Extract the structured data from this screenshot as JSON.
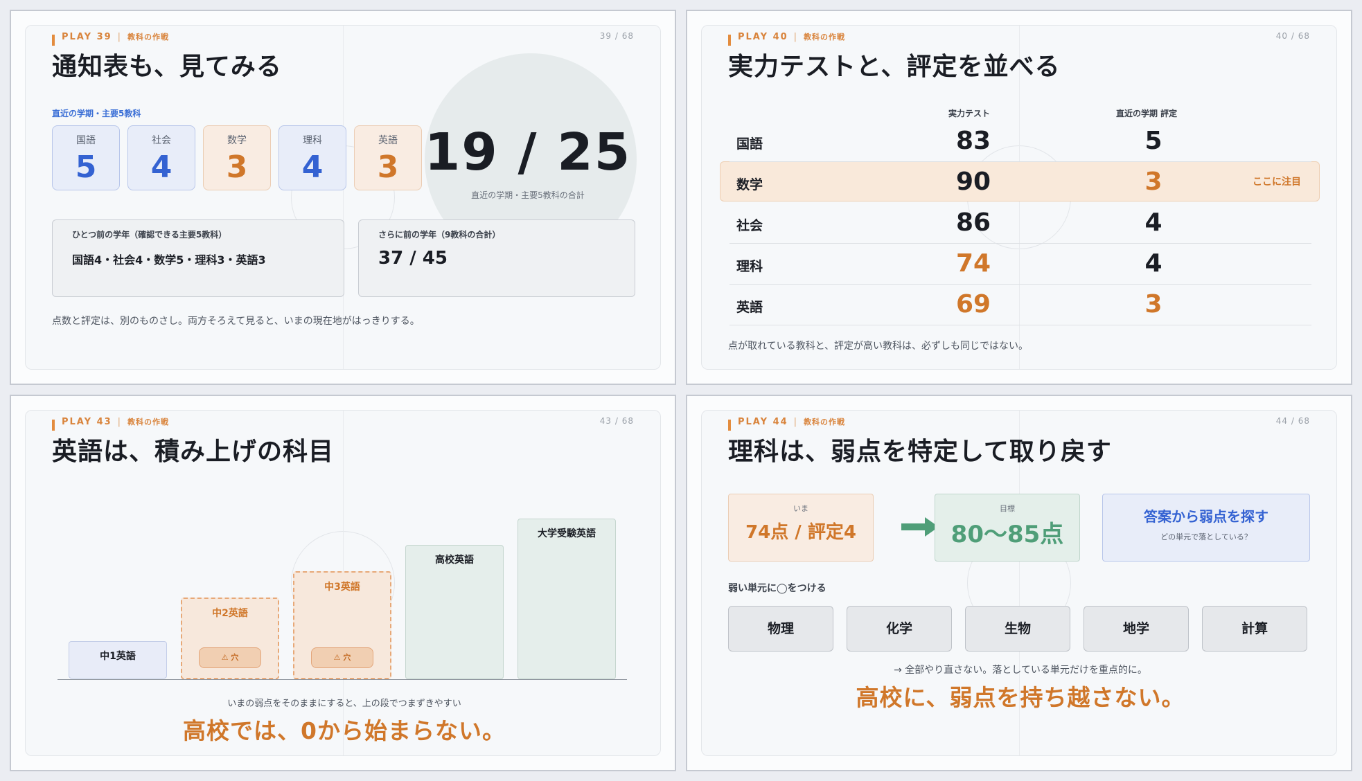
{
  "slide1": {
    "play": "PLAY 39",
    "category": "教科の作戦",
    "page": "39 / 68",
    "title": "通知表も、見てみる",
    "section_label": "直近の学期・主要5教科",
    "subjects": [
      {
        "name": "国語",
        "grade": "5",
        "color": "blue"
      },
      {
        "name": "社会",
        "grade": "4",
        "color": "blue"
      },
      {
        "name": "数学",
        "grade": "3",
        "color": "orange"
      },
      {
        "name": "理科",
        "grade": "4",
        "color": "blue"
      },
      {
        "name": "英語",
        "grade": "3",
        "color": "orange"
      }
    ],
    "total": "19 / 25",
    "total_caption": "直近の学期・主要5教科の合計",
    "prev_year": {
      "heading": "ひとつ前の学年（確認できる主要5教科）",
      "body": "国語4・社会4・数学5・理科3・英語3"
    },
    "prev_prev_year": {
      "heading": "さらに前の学年（9教科の合計）",
      "body": "37 / 45"
    },
    "footer": "点数と評定は、別のものさし。両方そろえて見ると、いまの現在地がはっきりする。"
  },
  "slide2": {
    "play": "PLAY 40",
    "category": "教科の作戦",
    "page": "40 / 68",
    "title": "実力テストと、評定を並べる",
    "col_test": "実力テスト",
    "col_rating": "直近の学期 評定",
    "rows": [
      {
        "subject": "国語",
        "score": "83",
        "rating": "5",
        "score_color": "#1a1d24",
        "rating_color": "#1a1d24"
      },
      {
        "subject": "数学",
        "score": "90",
        "rating": "3",
        "score_color": "#1a1d24",
        "rating_color": "#d0772a"
      },
      {
        "subject": "社会",
        "score": "86",
        "rating": "4",
        "score_color": "#1a1d24",
        "rating_color": "#1a1d24"
      },
      {
        "subject": "理科",
        "score": "74",
        "rating": "4",
        "score_color": "#d0772a",
        "rating_color": "#1a1d24"
      },
      {
        "subject": "英語",
        "score": "69",
        "rating": "3",
        "score_color": "#d0772a",
        "rating_color": "#d0772a"
      }
    ],
    "note": "ここに注目",
    "footer": "点が取れている教科と、評定が高い教科は、必ずしも同じではない。"
  },
  "slide3": {
    "play": "PLAY 43",
    "category": "教科の作戦",
    "page": "43 / 68",
    "title": "英語は、積み上げの科目",
    "steps": [
      {
        "label": "中1英語"
      },
      {
        "label": "中2英語",
        "badge": "⚠ 穴"
      },
      {
        "label": "中3英語",
        "badge": "⚠ 穴"
      },
      {
        "label": "高校英語"
      },
      {
        "label": "大学受験英語"
      }
    ],
    "caption": "いまの弱点をそのままにすると、上の段でつまずきやすい",
    "message": "高校では、0から始まらない。"
  },
  "slide4": {
    "play": "PLAY 44",
    "category": "教科の作戦",
    "page": "44 / 68",
    "title": "理科は、弱点を特定して取り戻す",
    "now": {
      "key": "いま",
      "value": "74点 / 評定4"
    },
    "goal": {
      "key": "目標",
      "value": "80〜85点"
    },
    "action": {
      "title": "答案から弱点を探す",
      "sub": "どの単元で落としている？"
    },
    "units_heading": "弱い単元に◯をつける",
    "units": [
      "物理",
      "化学",
      "生物",
      "地学",
      "計算"
    ],
    "caption": "→ 全部やり直さない。落としている単元だけを重点的に。",
    "message": "高校に、弱点を持ち越さない。"
  }
}
